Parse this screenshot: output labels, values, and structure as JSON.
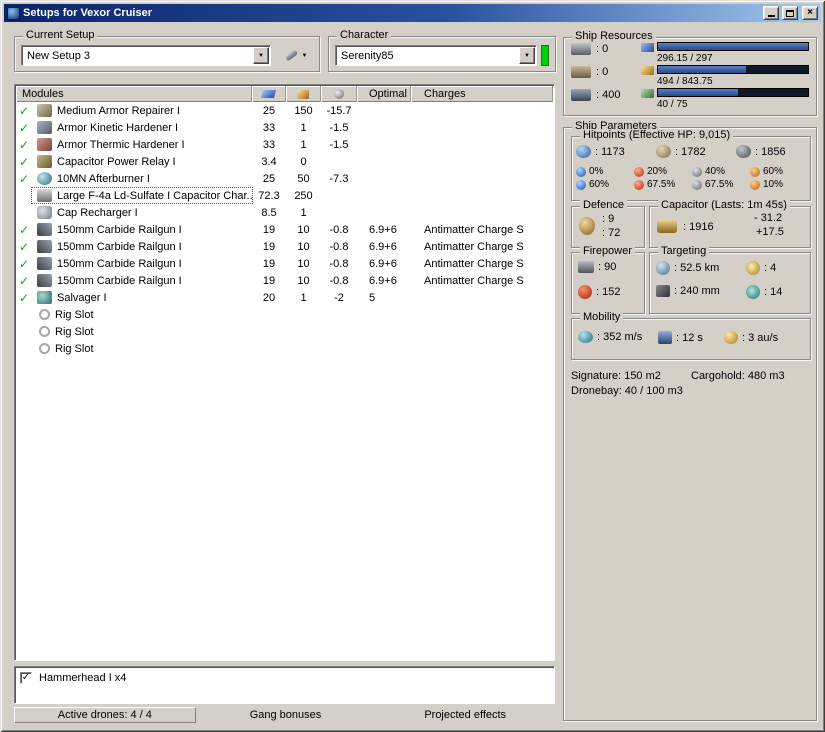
{
  "window": {
    "title": "Setups for Vexor Cruiser"
  },
  "icons": {
    "close": "×",
    "dropdown": "▼",
    "check": "✓"
  },
  "colors": {
    "titlebar_start": "#0a246a",
    "titlebar_end": "#a6caf0",
    "active_check_green": "#00b400",
    "bar_fill_blue": "#3b5fa0",
    "character_status": "#00d400"
  },
  "setup": {
    "label": "Current Setup",
    "value": "New Setup 3"
  },
  "character": {
    "label": "Character",
    "value": "Serenity85"
  },
  "ship_resources": {
    "label": "Ship Resources",
    "slots": [
      {
        "name": "turret-hardpoints",
        "value": ": 0"
      },
      {
        "name": "launcher-hardpoints",
        "value": ": 0"
      },
      {
        "name": "calibration",
        "value": ": 400"
      }
    ],
    "bars": [
      {
        "name": "cpu",
        "text": "296.15 / 297",
        "fill": "99.7%"
      },
      {
        "name": "powergrid",
        "text": "494 / 843.75",
        "fill": "58.6%"
      },
      {
        "name": "drone-bandwidth",
        "text": "40 / 75",
        "fill": "53.3%"
      }
    ]
  },
  "modules": {
    "header": {
      "modules": "Modules",
      "optimal": "Optimal",
      "charges": "Charges"
    },
    "rows": [
      {
        "check": "✓",
        "name": "Medium Armor Repairer I",
        "cpu": "25",
        "pg": "150",
        "cap": "-15.7",
        "optimal": "",
        "charges": ""
      },
      {
        "check": "✓",
        "name": "Armor Kinetic Hardener I",
        "cpu": "33",
        "pg": "1",
        "cap": "-1.5",
        "optimal": "",
        "charges": ""
      },
      {
        "check": "✓",
        "name": "Armor Thermic Hardener I",
        "cpu": "33",
        "pg": "1",
        "cap": "-1.5",
        "optimal": "",
        "charges": ""
      },
      {
        "check": "✓",
        "name": "Capacitor Power Relay I",
        "cpu": "3.4",
        "pg": "0",
        "cap": "",
        "optimal": "",
        "charges": ""
      },
      {
        "check": "✓",
        "name": "10MN Afterburner I",
        "cpu": "25",
        "pg": "50",
        "cap": "-7.3",
        "optimal": "",
        "charges": ""
      },
      {
        "check": "",
        "name": "Large F-4a Ld-Sulfate I Capacitor Char...",
        "cpu": "72.3",
        "pg": "250",
        "cap": "",
        "optimal": "",
        "charges": "",
        "selected": true
      },
      {
        "check": "",
        "name": "Cap Recharger I",
        "cpu": "8.5",
        "pg": "1",
        "cap": "",
        "optimal": "",
        "charges": ""
      },
      {
        "check": "✓",
        "name": "150mm Carbide Railgun I",
        "cpu": "19",
        "pg": "10",
        "cap": "-0.8",
        "optimal": "6.9+6",
        "charges": "Antimatter Charge S"
      },
      {
        "check": "✓",
        "name": "150mm Carbide Railgun I",
        "cpu": "19",
        "pg": "10",
        "cap": "-0.8",
        "optimal": "6.9+6",
        "charges": "Antimatter Charge S"
      },
      {
        "check": "✓",
        "name": "150mm Carbide Railgun I",
        "cpu": "19",
        "pg": "10",
        "cap": "-0.8",
        "optimal": "6.9+6",
        "charges": "Antimatter Charge S"
      },
      {
        "check": "✓",
        "name": "150mm Carbide Railgun I",
        "cpu": "19",
        "pg": "10",
        "cap": "-0.8",
        "optimal": "6.9+6",
        "charges": "Antimatter Charge S"
      },
      {
        "check": "✓",
        "name": "Salvager I",
        "cpu": "20",
        "pg": "1",
        "cap": "-2",
        "optimal": "5",
        "charges": ""
      },
      {
        "check": "",
        "name": "Rig Slot",
        "cpu": "",
        "pg": "",
        "cap": "",
        "optimal": "",
        "charges": ""
      },
      {
        "check": "",
        "name": "Rig Slot",
        "cpu": "",
        "pg": "",
        "cap": "",
        "optimal": "",
        "charges": ""
      },
      {
        "check": "",
        "name": "Rig Slot",
        "cpu": "",
        "pg": "",
        "cap": "",
        "optimal": "",
        "charges": ""
      }
    ]
  },
  "params": {
    "label": "Ship Parameters",
    "hitpoints": {
      "label": "Hitpoints (Effective HP: 9,015)",
      "pools": [
        {
          "name": "shield",
          "value": ": 1173"
        },
        {
          "name": "armor",
          "value": ": 1782"
        },
        {
          "name": "structure",
          "value": ": 1856"
        }
      ],
      "resists": [
        {
          "type": "em",
          "shield": "0%",
          "armor": "60%"
        },
        {
          "type": "thermal",
          "shield": "20%",
          "armor": "67.5%"
        },
        {
          "type": "kinetic",
          "shield": "40%",
          "armor": "67.5%"
        },
        {
          "type": "explosive",
          "shield": "60%",
          "armor": "10%"
        }
      ]
    },
    "defence": {
      "label": "Defence",
      "line1": ": 9",
      "line2": ": 72"
    },
    "capacitor": {
      "label": "Capacitor (Lasts: 1m 45s)",
      "amount": ": 1916",
      "peak_drain": "- 31.2",
      "recharge": "+17.5"
    },
    "firepower": {
      "label": "Firepower",
      "volley": ": 90",
      "dps": ": 152"
    },
    "targeting": {
      "label": "Targeting",
      "range": ": 52.5 km",
      "max_targets": ": 4",
      "signature": ": 240 mm",
      "sensor_strength": ": 14"
    },
    "mobility": {
      "label": "Mobility",
      "speed": ": 352 m/s",
      "align_time": ": 12 s",
      "warp_speed": ": 3 au/s"
    },
    "signature": "Signature: 150 m2",
    "cargohold": "Cargohold: 480 m3",
    "dronebay": "Dronebay: 40 / 100 m3"
  },
  "drones": {
    "items": [
      {
        "checked": true,
        "label": "Hammerhead I x4"
      }
    ]
  },
  "bottom": {
    "active_drones": "Active drones: 4 / 4",
    "gang_bonuses": "Gang bonuses",
    "projected_effects": "Projected effects"
  }
}
